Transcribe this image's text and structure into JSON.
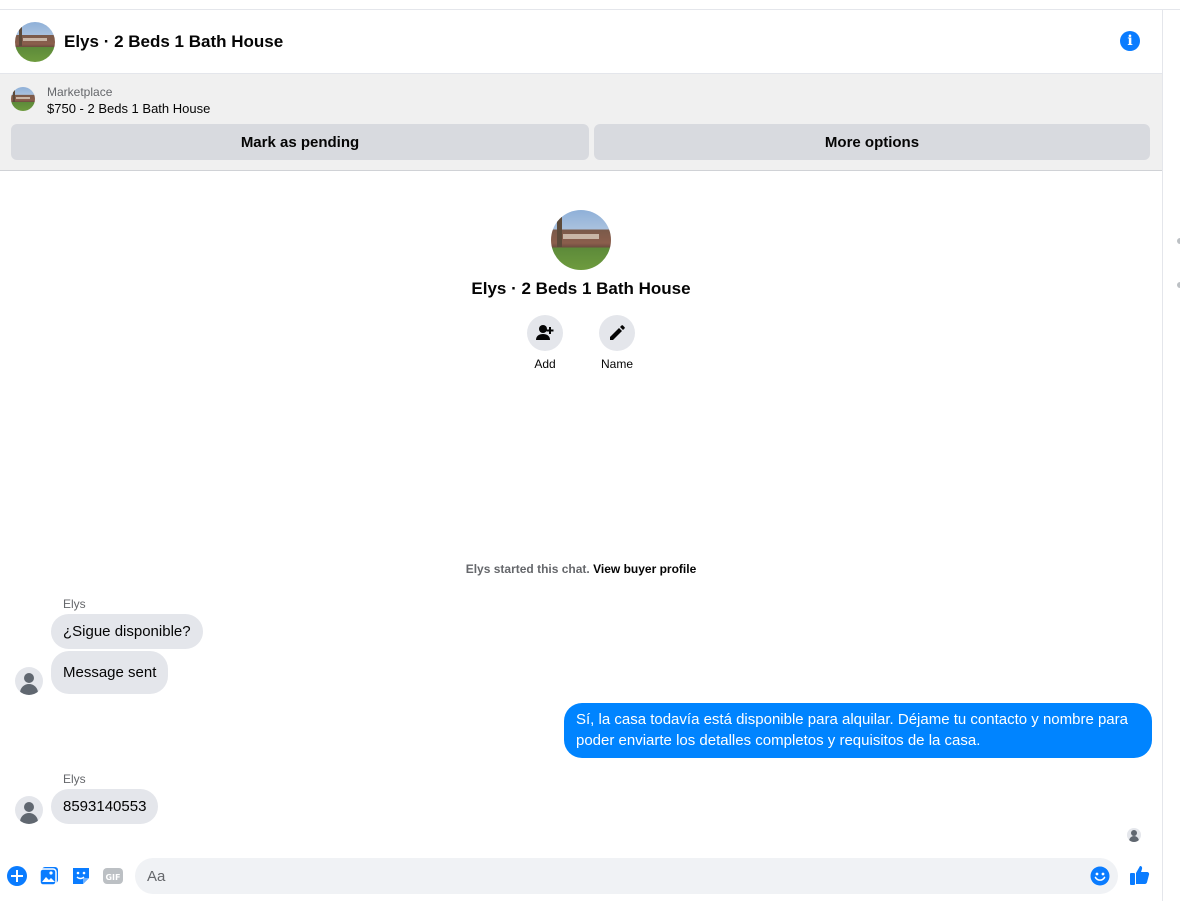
{
  "header": {
    "title": "Elys · 2 Beds 1 Bath House"
  },
  "marketplace": {
    "label": "Marketplace",
    "item": "$750 - 2 Beds 1 Bath House",
    "mark_pending_label": "Mark as pending",
    "more_options_label": "More options"
  },
  "intro": {
    "title": "Elys · 2 Beds 1 Bath House",
    "add_label": "Add",
    "name_label": "Name"
  },
  "started": {
    "text": "Elys started this chat.",
    "link": "View buyer profile"
  },
  "messages": [
    {
      "sender": "Elys",
      "text": "¿Sigue disponible?"
    },
    {
      "text": "Message sent"
    },
    {
      "outgoing": true,
      "text": "Sí, la casa todavía está disponible para alquilar. Déjame tu contacto y nombre para poder enviarte los detalles completos y requisitos de la casa."
    },
    {
      "sender": "Elys",
      "text": "8593140553"
    }
  ],
  "composer": {
    "placeholder": "Aa",
    "icons": [
      "plus-icon",
      "photo-icon",
      "sticker-icon",
      "gif-icon",
      "emoji-icon",
      "thumbs-up-icon"
    ],
    "gif_text": "GIF"
  },
  "colors": {
    "accent": "#0084ff",
    "icon_blue": "#0a7cff",
    "incoming_bubble": "#e4e6eb",
    "panel_bg": "#f0f0f0",
    "button_bg": "#d8dadf"
  }
}
